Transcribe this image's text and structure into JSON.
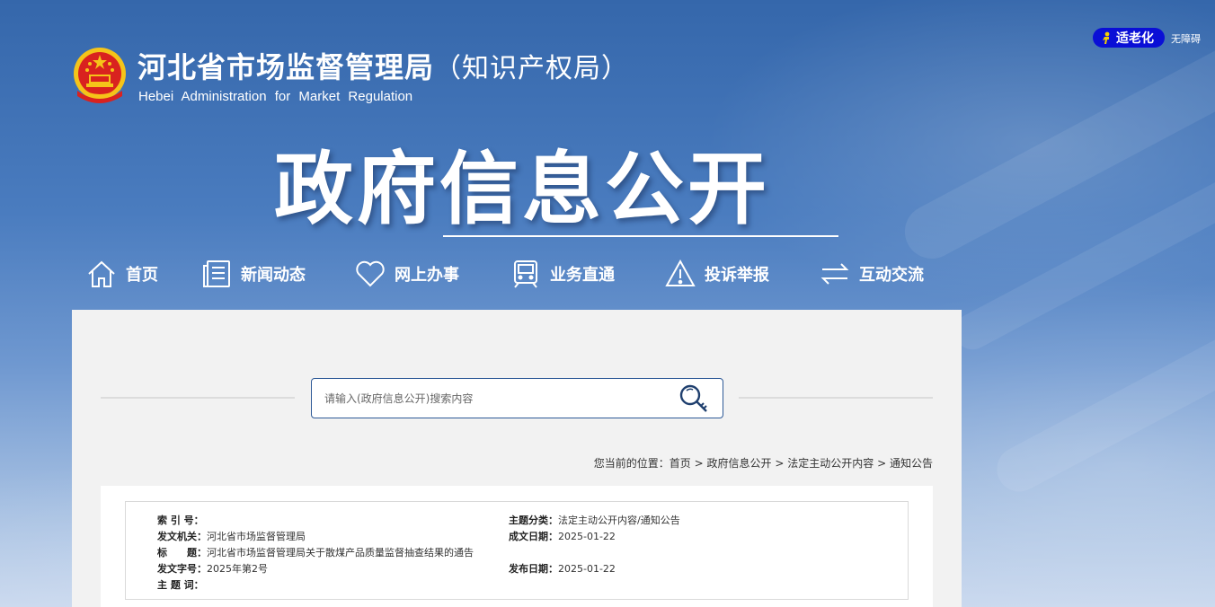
{
  "header": {
    "title": "河北省市场监督管理局",
    "title_suffix": "（知识产权局）",
    "title_en": "Hebei Administration for Market Regulation",
    "elder_mode": "适老化",
    "accessibility": "无障碍"
  },
  "banner": {
    "title": "政府信息公开"
  },
  "nav": {
    "items": [
      {
        "label": "首页",
        "icon": "home-icon"
      },
      {
        "label": "新闻动态",
        "icon": "news-icon"
      },
      {
        "label": "网上办事",
        "icon": "heart-icon"
      },
      {
        "label": "业务直通",
        "icon": "train-icon"
      },
      {
        "label": "投诉举报",
        "icon": "warning-icon"
      },
      {
        "label": "互动交流",
        "icon": "exchange-icon"
      }
    ]
  },
  "search": {
    "placeholder": "请输入(政府信息公开)搜索内容"
  },
  "breadcrumb": {
    "prefix": "您当前的位置：",
    "items": [
      "首页",
      "政府信息公开",
      "法定主动公开内容",
      "通知公告"
    ],
    "separator": ">"
  },
  "meta": {
    "index_label": "索 引 号：",
    "index_value": "",
    "category_label": "主题分类：",
    "category_value": "法定主动公开内容/通知公告",
    "issuer_label": "发文机关：",
    "issuer_value": "河北省市场监督管理局",
    "created_label": "成文日期：",
    "created_value": "2025-01-22",
    "title_label": "标　　题：",
    "title_value": "河北省市场监督管理局关于散煤产品质量监督抽查结果的通告",
    "docno_label": "发文字号：",
    "docno_value": "2025年第2号",
    "published_label": "发布日期：",
    "published_value": "2025-01-22",
    "keywords_label": "主 题 词：",
    "keywords_value": ""
  },
  "colors": {
    "elder_button": "#0a0fd6",
    "search_border": "#2e5a97",
    "panel_bg": "#f2f2f2"
  }
}
